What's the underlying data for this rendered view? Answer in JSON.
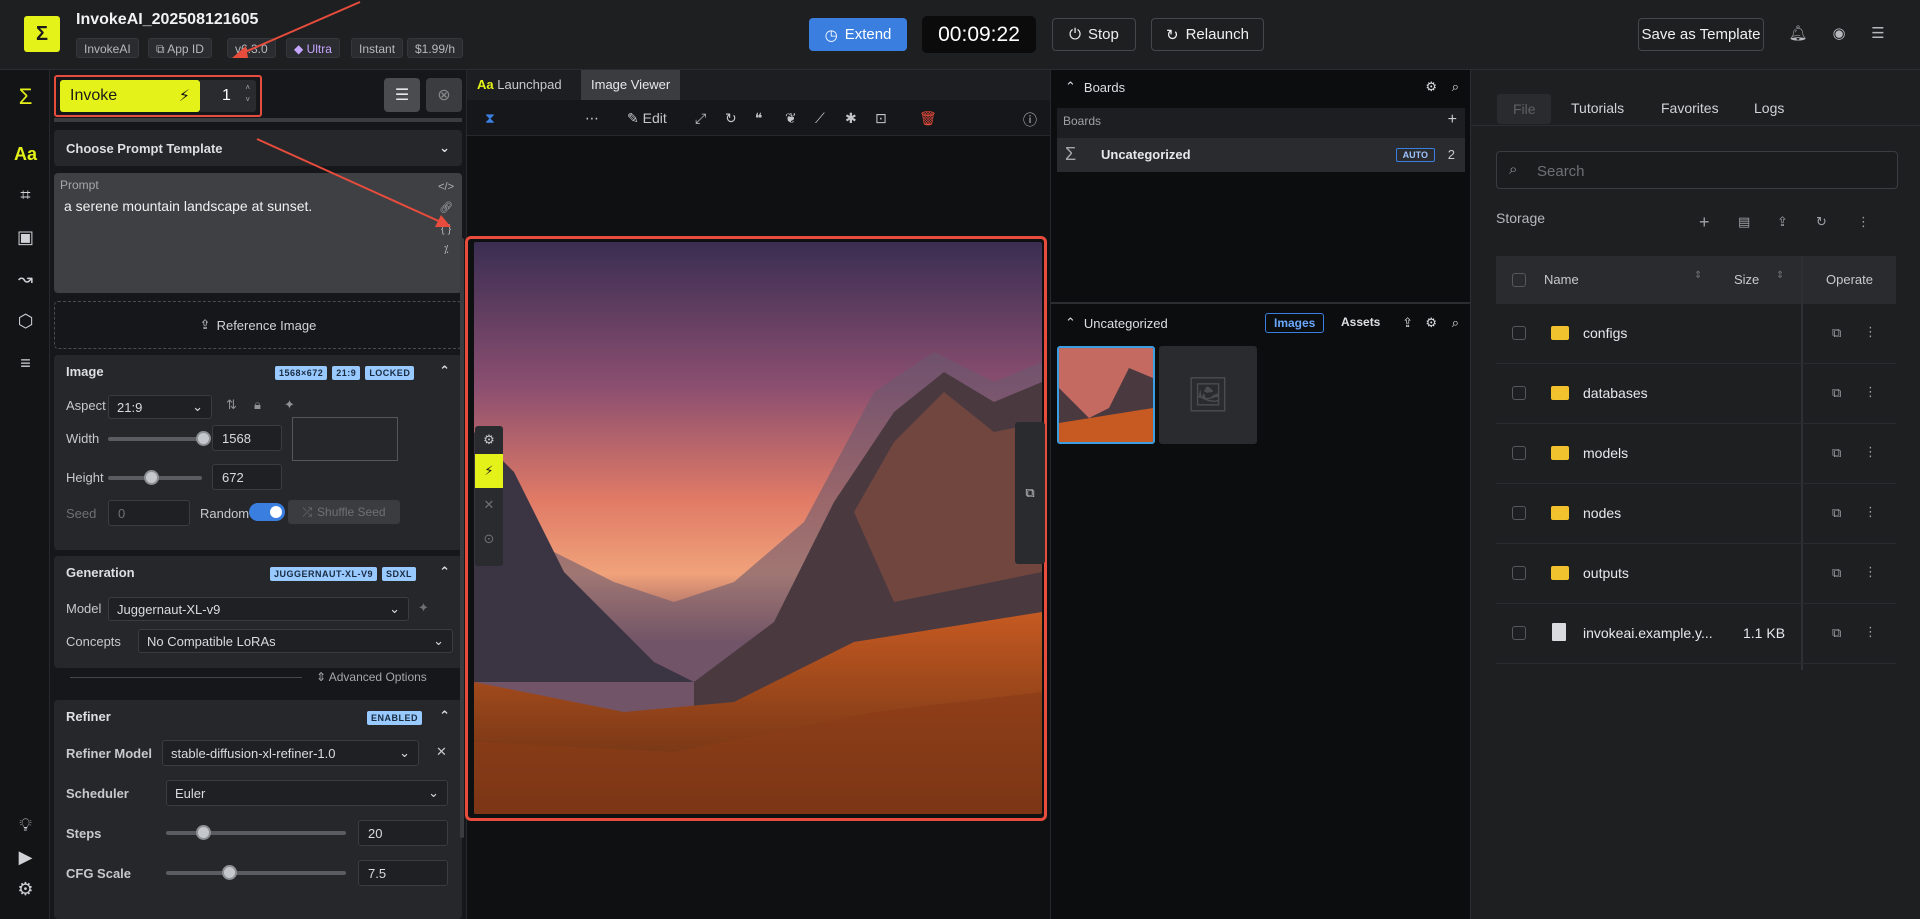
{
  "topbar": {
    "logo": "invoke-logo",
    "title": "InvokeAI_202508121605",
    "chips": [
      "InvokeAI",
      "App ID",
      "v6.3.0",
      "Ultra",
      "Instant",
      "$1.99/h"
    ],
    "extend_label": "Extend",
    "timer": "00:09:22",
    "stop_label": "Stop",
    "relaunch_label": "Relaunch",
    "save_template_label": "Save as Template"
  },
  "left": {
    "invoke_label": "Invoke",
    "count": "1",
    "prompt_template": "Choose Prompt Template",
    "prompt_label": "Prompt",
    "prompt_text": "a serene mountain landscape at sunset.",
    "reference_image": "Reference Image",
    "image_section": {
      "title": "Image",
      "badges": [
        "1568×672",
        "21:9",
        "LOCKED"
      ],
      "aspect_label": "Aspect",
      "aspect_value": "21:9",
      "width_label": "Width",
      "width_value": "1568",
      "height_label": "Height",
      "height_value": "672",
      "seed_label": "Seed",
      "seed_value": "0",
      "random_label": "Random",
      "shuffle_label": "Shuffle Seed"
    },
    "generation": {
      "title": "Generation",
      "badges": [
        "JUGGERNAUT-XL-V9",
        "SDXL"
      ],
      "model_label": "Model",
      "model_value": "Juggernaut-XL-v9",
      "concepts_label": "Concepts",
      "concepts_value": "No Compatible LoRAs",
      "advanced": "Advanced Options"
    },
    "refiner": {
      "title": "Refiner",
      "badge": "ENABLED",
      "model_label": "Refiner Model",
      "model_value": "stable-diffusion-xl-refiner-1.0",
      "scheduler_label": "Scheduler",
      "scheduler_value": "Euler",
      "steps_label": "Steps",
      "steps_value": "20",
      "cfg_label": "CFG Scale",
      "cfg_value": "7.5"
    }
  },
  "center": {
    "tab_launchpad": "Launchpad",
    "tab_viewer": "Image Viewer",
    "edit_label": "Edit"
  },
  "boards": {
    "header": "Boards",
    "sub": "Boards",
    "board_name": "Uncategorized",
    "auto": "AUTO",
    "count": "2",
    "gallery_title": "Uncategorized",
    "tab_images": "Images",
    "tab_assets": "Assets"
  },
  "files": {
    "tabs": [
      "File",
      "Tutorials",
      "Favorites",
      "Logs"
    ],
    "search_placeholder": "Search",
    "storage": "Storage",
    "col_name": "Name",
    "col_size": "Size",
    "col_operate": "Operate",
    "rows": [
      {
        "name": "configs",
        "size": ""
      },
      {
        "name": "databases",
        "size": ""
      },
      {
        "name": "models",
        "size": ""
      },
      {
        "name": "nodes",
        "size": ""
      },
      {
        "name": "outputs",
        "size": ""
      },
      {
        "name": "invokeai.example.y...",
        "size": "1.1 KB"
      }
    ]
  }
}
